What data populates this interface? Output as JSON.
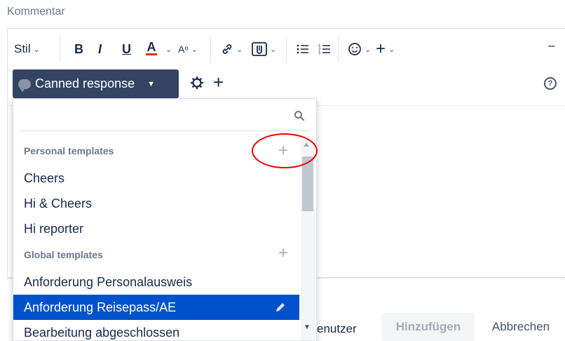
{
  "comment_label": "Kommentar",
  "toolbar": {
    "style_label": "Stil",
    "bold": "B",
    "italic": "I",
    "underline": "U",
    "text_color": "A",
    "more_format": "Aᵒ",
    "accent_red": "#de350b"
  },
  "canned": {
    "button_label": "Canned response"
  },
  "dropdown": {
    "personal_header": "Personal templates",
    "personal_items": [
      "Cheers",
      "Hi & Cheers",
      "Hi reporter"
    ],
    "global_header": "Global templates",
    "global_items": [
      "Anforderung Personalausweis",
      "Anforderung Reisepass/AE",
      "Bearbeitung abgeschlossen"
    ],
    "selected_item": "Anforderung Reisepass/AE",
    "selected_color": "#0052cc"
  },
  "footer": {
    "user_text": "enutzer",
    "add_label": "Hinzufügen",
    "cancel_label": "Abbrechen"
  }
}
